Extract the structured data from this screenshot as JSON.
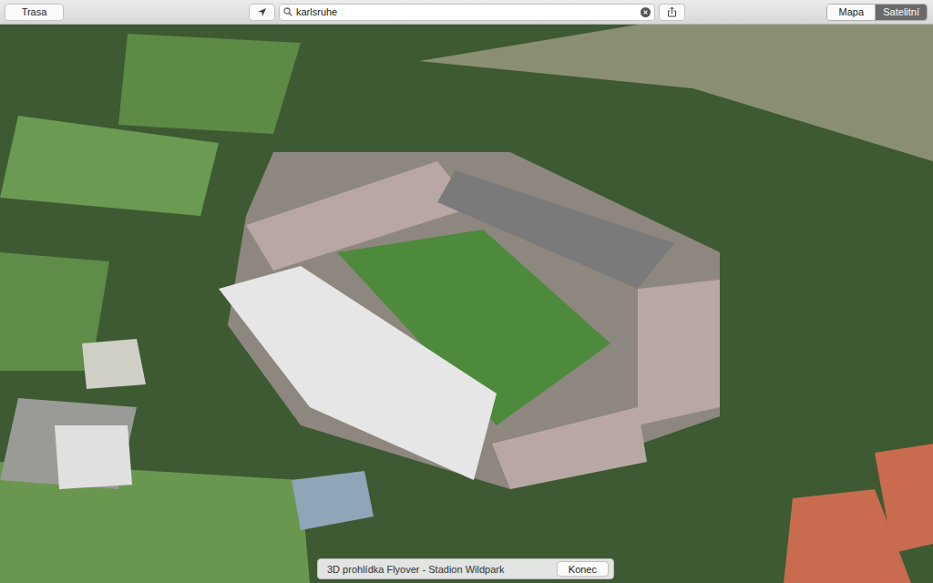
{
  "toolbar": {
    "route_button": "Trasa",
    "search": {
      "value": "karlsruhe"
    },
    "view_modes": [
      {
        "label": "Mapa",
        "selected": false
      },
      {
        "label": "Satelitní",
        "selected": true
      }
    ]
  },
  "flyover_bar": {
    "title": "3D prohlídka Flyover - Stadion Wildpark",
    "end_button": "Konec"
  }
}
